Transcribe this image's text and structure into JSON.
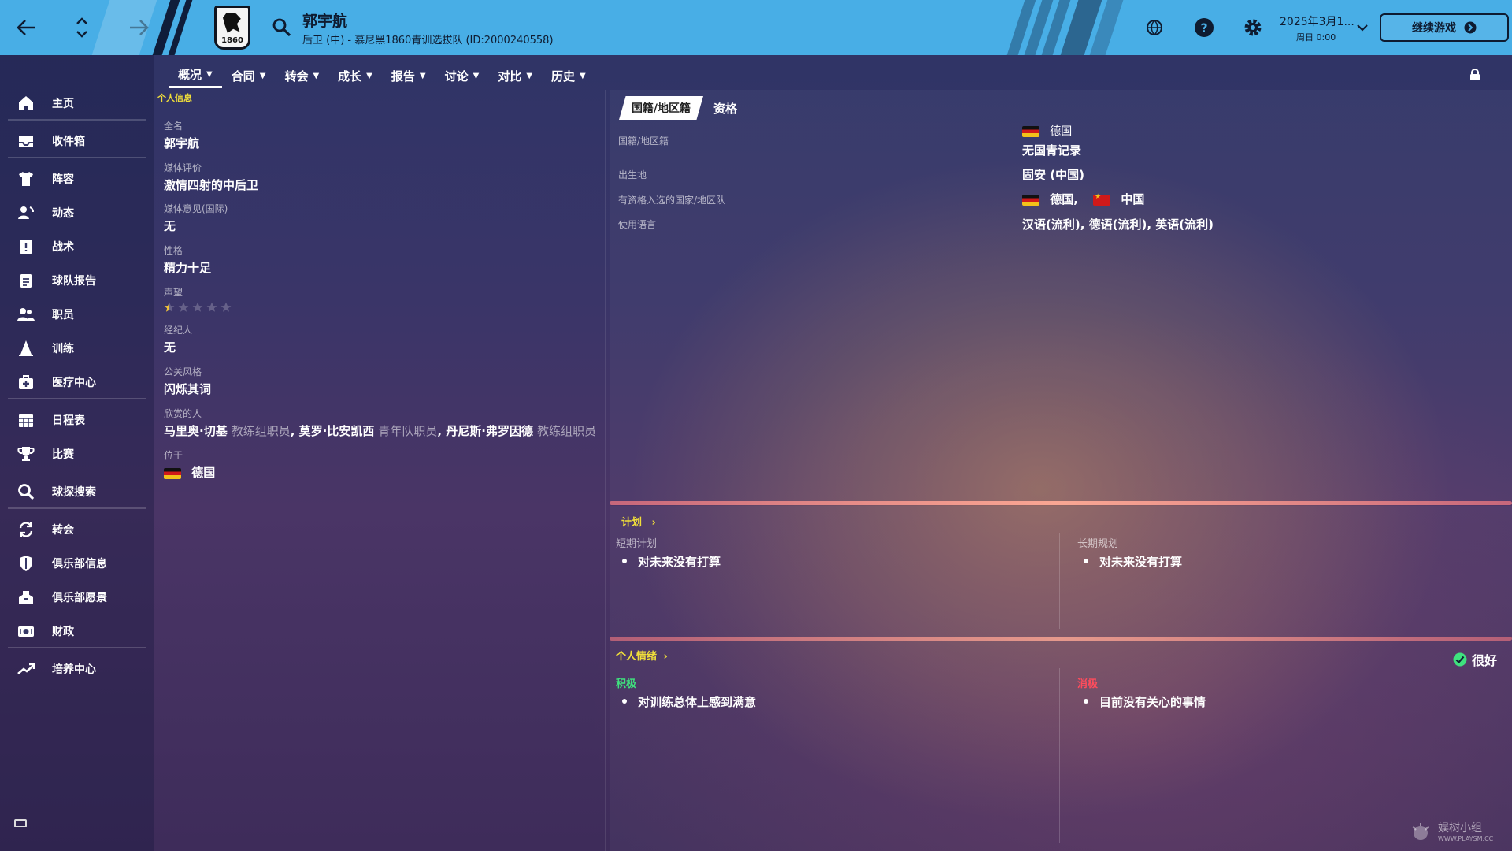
{
  "topbar": {
    "player_name": "郭宇航",
    "player_subtitle": "后卫 (中) - 慕尼黑1860青训选拔队 (ID:2000240558)",
    "crest_text": "1860",
    "date": "2025年3月1...",
    "time": "周日 0:00",
    "continue_label": "继续游戏",
    "icons": [
      "back-arrow-icon",
      "up-down-chevron-icon",
      "forward-arrow-icon",
      "search-icon",
      "globe-icon",
      "help-icon",
      "gear-icon",
      "chevron-down-icon"
    ]
  },
  "sidebar": {
    "items": [
      {
        "label": "主页",
        "icon": "home-icon"
      },
      {
        "label": "收件箱",
        "icon": "inbox-icon"
      },
      {
        "label": "阵容",
        "icon": "shirt-icon"
      },
      {
        "label": "动态",
        "icon": "dynamics-icon"
      },
      {
        "label": "战术",
        "icon": "tactics-icon"
      },
      {
        "label": "球队报告",
        "icon": "clipboard-icon"
      },
      {
        "label": "职员",
        "icon": "staff-icon"
      },
      {
        "label": "训练",
        "icon": "training-icon"
      },
      {
        "label": "医疗中心",
        "icon": "medical-icon"
      },
      {
        "label": "日程表",
        "icon": "calendar-icon"
      },
      {
        "label": "比赛",
        "icon": "trophy-icon"
      },
      {
        "label": "球探搜索",
        "icon": "search-icon"
      },
      {
        "label": "转会",
        "icon": "transfer-icon"
      },
      {
        "label": "俱乐部信息",
        "icon": "shield-icon"
      },
      {
        "label": "俱乐部愿景",
        "icon": "vision-icon"
      },
      {
        "label": "财政",
        "icon": "finance-icon"
      },
      {
        "label": "培养中心",
        "icon": "development-icon"
      }
    ]
  },
  "tabs": [
    {
      "label": "概况"
    },
    {
      "label": "合同"
    },
    {
      "label": "转会"
    },
    {
      "label": "成长"
    },
    {
      "label": "报告"
    },
    {
      "label": "讨论"
    },
    {
      "label": "对比"
    },
    {
      "label": "历史"
    }
  ],
  "personal": {
    "section_label": "个人信息",
    "fullname_label": "全名",
    "fullname": "郭宇航",
    "media_rating_label": "媒体评价",
    "media_rating": "激情四射的中后卫",
    "media_opinion_label": "媒体意见(国际)",
    "media_opinion": "无",
    "personality_label": "性格",
    "personality": "精力十足",
    "reputation_label": "声望",
    "reputation_stars": 0.5,
    "reputation_max": 5,
    "agent_label": "经纪人",
    "agent": "无",
    "pr_style_label": "公关风格",
    "pr_style": "闪烁其词",
    "admired_label": "欣赏的人",
    "admired": [
      {
        "name": "马里奥·切基",
        "role": "教练组职员"
      },
      {
        "name": "莫罗·比安凯西",
        "role": "青年队职员"
      },
      {
        "name": "丹尼斯·弗罗因德",
        "role": "教练组职员"
      }
    ],
    "location_label": "位于",
    "location": "德国"
  },
  "nationality": {
    "tab_active": "国籍/地区籍",
    "tab_other": "资格",
    "nationality_label": "国籍/地区籍",
    "nationality_value": "德国",
    "caps_value": "无国青记录",
    "birthplace_label": "出生地",
    "birthplace_value": "固安 (中国)",
    "eligible_label": "有资格入选的国家/地区队",
    "eligible_1": "德国,",
    "eligible_2": "中国",
    "languages_label": "使用语言",
    "languages_value": "汉语(流利), 德语(流利), 英语(流利)"
  },
  "plans": {
    "heading": "计划",
    "short_label": "短期计划",
    "short_value": "对未来没有打算",
    "long_label": "长期规划",
    "long_value": "对未来没有打算"
  },
  "mood": {
    "heading": "个人情绪",
    "status": "很好",
    "positive_label": "积极",
    "positive_value": "对训练总体上感到满意",
    "negative_label": "消极",
    "negative_value": "目前没有关心的事情"
  },
  "watermark": {
    "text": "娱树小组",
    "sub": "WWW.PLAYSM.CC"
  },
  "colors": {
    "topbar": "#48aee6",
    "accent_yellow": "#f0de3a",
    "positive": "#3fe27e",
    "negative": "#ff4c5c"
  }
}
